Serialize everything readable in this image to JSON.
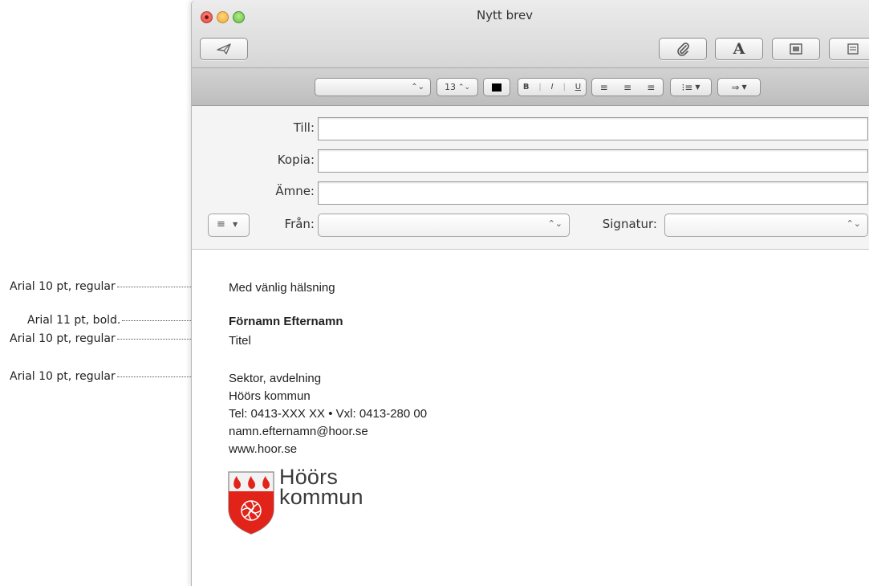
{
  "window": {
    "title": "Nytt brev"
  },
  "format_bar": {
    "font_family_value": "",
    "font_size_value": "13",
    "bold_label": "B",
    "italic_label": "I",
    "underline_label": "U"
  },
  "header_fields": {
    "to_label": "Till:",
    "to_value": "",
    "cc_label": "Kopia:",
    "cc_value": "",
    "subject_label": "Ämne:",
    "subject_value": "",
    "from_label": "Från:",
    "from_value": "",
    "signature_label": "Signatur:",
    "signature_value": ""
  },
  "annotations": [
    "Arial 10 pt, regular",
    "Arial 11 pt, bold.",
    "Arial 10 pt, regular",
    "Arial 10 pt, regular"
  ],
  "signature": {
    "greeting": "Med vänlig hälsning",
    "name": "Förnamn Efternamn",
    "title": "Titel",
    "department": "Sektor, avdelning",
    "organization": "Höörs kommun",
    "phone": "Tel: 0413-XXX XX • Vxl: 0413-280 00",
    "email": "namn.efternamn@hoor.se",
    "website": "www.hoor.se"
  },
  "logo": {
    "line1": "Höörs",
    "line2": "kommun",
    "shield_color": "#e2231a",
    "flame_color": "#e2231a"
  },
  "icons": {
    "send": "paper-plane-icon",
    "attach": "paperclip-icon",
    "fonts": "font-a-icon",
    "photo": "photo-browser-icon",
    "stationery": "stationery-icon",
    "header_options": "list-menu-icon",
    "color": "color-swatch-icon",
    "align_left": "align-left-icon",
    "align_center": "align-center-icon",
    "align_right": "align-right-icon",
    "list": "bullet-list-icon",
    "indent": "indent-arrow-icon"
  }
}
